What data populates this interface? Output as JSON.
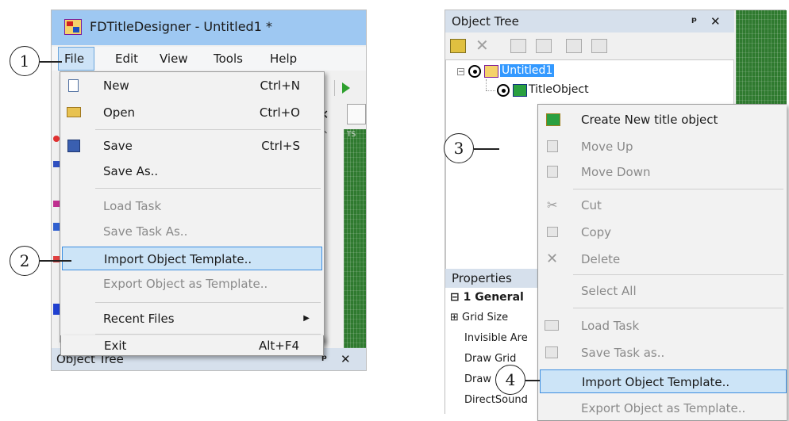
{
  "left": {
    "app_title": "FDTitleDesigner - Untitled1 *",
    "menubar": [
      "File",
      "Edit",
      "View",
      "Tools",
      "Help"
    ],
    "file_menu": {
      "items": [
        {
          "label": "New",
          "shortcut": "Ctrl+N",
          "icon": "new-file-icon",
          "disabled": false
        },
        {
          "label": "Open",
          "shortcut": "Ctrl+O",
          "icon": "open-folder-icon",
          "disabled": false
        },
        {
          "label": "Save",
          "shortcut": "Ctrl+S",
          "icon": "save-icon",
          "disabled": false
        },
        {
          "label": "Save As..",
          "shortcut": "",
          "icon": "",
          "disabled": false
        },
        {
          "label": "Load Task",
          "shortcut": "",
          "icon": "",
          "disabled": true
        },
        {
          "label": "Save Task As..",
          "shortcut": "",
          "icon": "",
          "disabled": true
        },
        {
          "label": "Import Object Template..",
          "shortcut": "",
          "icon": "",
          "disabled": false,
          "highlighted": true
        },
        {
          "label": "Export Object as Template..",
          "shortcut": "",
          "icon": "",
          "disabled": true
        },
        {
          "label": "Recent Files",
          "shortcut": "",
          "icon": "",
          "disabled": false,
          "submenu": true
        },
        {
          "label": "Exit",
          "shortcut": "Alt+F4",
          "icon": "",
          "disabled": false
        }
      ]
    },
    "bottom_panel": "Object Tree",
    "pin_glyph": "ᵖ",
    "close_glyph": "✕",
    "tab_fragment": "TS"
  },
  "right": {
    "panel_title": "Object Tree",
    "tree": {
      "root": "Untitled1",
      "child": "TitleObject"
    },
    "context_menu": [
      {
        "label": "Create New title object",
        "icon": "create-object-icon",
        "disabled": false
      },
      {
        "label": "Move Up",
        "icon": "move-up-icon",
        "disabled": true
      },
      {
        "label": "Move Down",
        "icon": "move-down-icon",
        "disabled": true
      },
      {
        "label": "Cut",
        "icon": "cut-icon",
        "disabled": true
      },
      {
        "label": "Copy",
        "icon": "copy-icon",
        "disabled": true
      },
      {
        "label": "Delete",
        "icon": "delete-icon",
        "disabled": true
      },
      {
        "label": "Select All",
        "icon": "",
        "disabled": true
      },
      {
        "label": "Load Task",
        "icon": "load-task-icon",
        "disabled": true
      },
      {
        "label": "Save Task as..",
        "icon": "save-task-icon",
        "disabled": true
      },
      {
        "label": "Import Object Template..",
        "icon": "",
        "disabled": false,
        "highlighted": true
      },
      {
        "label": "Export Object as Template..",
        "icon": "",
        "disabled": true
      }
    ],
    "properties_title": "Properties",
    "properties": {
      "section": "1 General",
      "rows": [
        "Grid Size",
        "Invisible Are",
        "Draw Grid",
        "Draw",
        "DirectSound"
      ]
    }
  },
  "callouts": [
    "1",
    "2",
    "3",
    "4"
  ]
}
